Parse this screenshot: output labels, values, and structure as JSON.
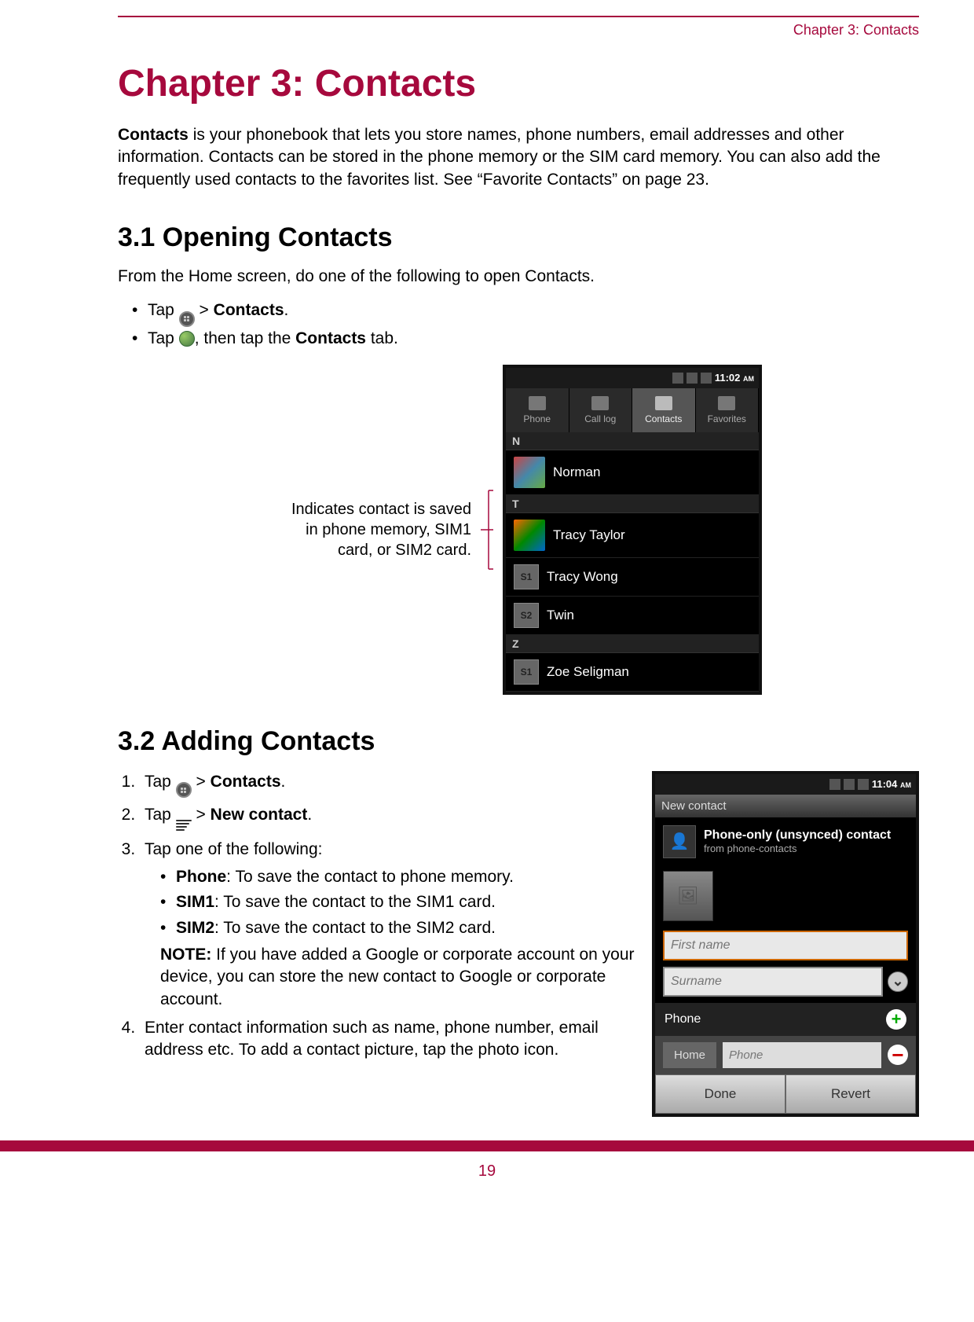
{
  "header": {
    "label": "Chapter 3: Contacts"
  },
  "chapterTitle": "Chapter 3: Contacts",
  "intro": {
    "boldWord": "Contacts",
    "rest": " is your phonebook that lets you store names, phone numbers, email addresses and other information. Contacts can be stored in the phone memory or the SIM card memory. You can also add the frequently used contacts to the favorites list. See “Favorite Contacts” on page 23."
  },
  "section31": {
    "title": "3.1 Opening Contacts",
    "lead": "From the Home screen, do one of the following to open Contacts.",
    "bullets": {
      "b1": {
        "pre": "Tap ",
        "mid": " > ",
        "bold": "Contacts",
        "post": "."
      },
      "b2": {
        "pre": "Tap ",
        "mid": ", then tap the ",
        "bold": "Contacts",
        "post": " tab."
      }
    },
    "callout": "Indicates contact is saved in phone memory, SIM1 card, or SIM2 card."
  },
  "phone1": {
    "time": "11:02 ",
    "ampm": "AM",
    "tabs": {
      "phone": "Phone",
      "calllog": "Call log",
      "contacts": "Contacts",
      "favorites": "Favorites"
    },
    "letters": {
      "N": "N",
      "T": "T",
      "Z": "Z"
    },
    "contacts": {
      "norman": "Norman",
      "tracyT": "Tracy Taylor",
      "tracyW": "Tracy Wong",
      "twin": "Twin",
      "zoe": "Zoe Seligman"
    },
    "sim": {
      "s1": "S1",
      "s2": "S2"
    }
  },
  "section32": {
    "title": "3.2 Adding Contacts",
    "steps": {
      "s1": {
        "pre": "Tap ",
        "mid": " > ",
        "bold": "Contacts",
        "post": "."
      },
      "s2": {
        "pre": "Tap ",
        "mid": " > ",
        "bold": "New contact",
        "post": "."
      },
      "s3": {
        "text": "Tap one of the following:",
        "phone": {
          "b": "Phone",
          "rest": ": To save the contact to phone memory."
        },
        "sim1": {
          "b": "SIM1",
          "rest": ": To save the contact to the SIM1 card."
        },
        "sim2": {
          "b": "SIM2",
          "rest": ": To save the contact to the SIM2 card."
        },
        "noteLabel": "NOTE:",
        "noteBody": " If you have added a Google or corporate account on your device, you can store the new contact to Google or corporate account."
      },
      "s4": "Enter contact information such as name, phone number, email address etc. To add a contact picture, tap the photo icon."
    }
  },
  "phone2": {
    "time": "11:04 ",
    "ampm": "AM",
    "title": "New contact",
    "infoTitle": "Phone-only (unsynced) contact",
    "infoSub": "from phone-contacts",
    "firstname": "First name",
    "surname": "Surname",
    "phoneLabel": "Phone",
    "home": "Home",
    "phonePlaceholder": "Phone",
    "done": "Done",
    "revert": "Revert"
  },
  "pageNumber": "19"
}
